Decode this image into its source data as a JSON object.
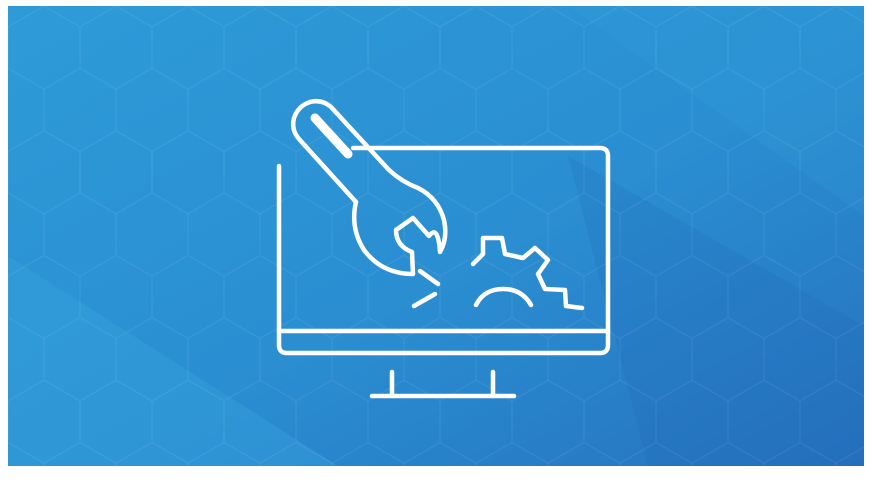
{
  "banner": {
    "background_colors": {
      "top_left": "#2E9BD8",
      "center": "#2A8ED1",
      "bottom_right": "#2671BF",
      "light_band": "#3AA7E0"
    },
    "hex_pattern_color": "#FFFFFF",
    "illustration": {
      "subject": "desktop-monitor-with-wrench-and-gear",
      "stroke_color": "#FFFFFF"
    }
  }
}
